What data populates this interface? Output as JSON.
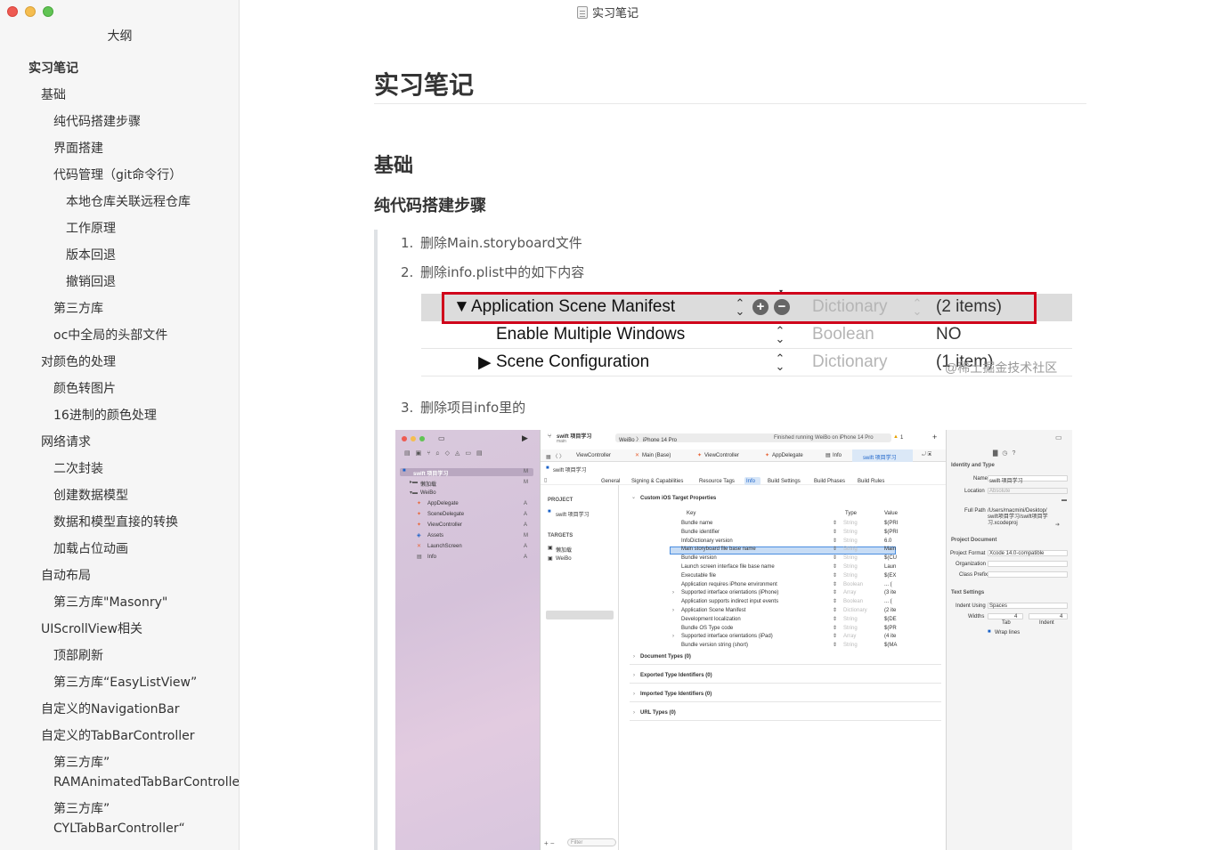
{
  "window": {
    "title": "实习笔记"
  },
  "sidebar": {
    "title": "大纲",
    "items": [
      {
        "label": "实习笔记",
        "level": 1
      },
      {
        "label": "基础",
        "level": 2
      },
      {
        "label": "纯代码搭建步骤",
        "level": 3
      },
      {
        "label": "界面搭建",
        "level": 3
      },
      {
        "label": "代码管理（git命令行）",
        "level": 3
      },
      {
        "label": "本地仓库关联远程仓库",
        "level": 4
      },
      {
        "label": "工作原理",
        "level": 4
      },
      {
        "label": "版本回退",
        "level": 4
      },
      {
        "label": "撤销回退",
        "level": 4
      },
      {
        "label": "第三方库",
        "level": 3
      },
      {
        "label": "oc中全局的头部文件",
        "level": 3
      },
      {
        "label": "对颜色的处理",
        "level": 2
      },
      {
        "label": "颜色转图片",
        "level": 3
      },
      {
        "label": "16进制的颜色处理",
        "level": 3
      },
      {
        "label": "网络请求",
        "level": 2
      },
      {
        "label": "二次封装",
        "level": 3
      },
      {
        "label": "创建数据模型",
        "level": 3
      },
      {
        "label": "数据和模型直接的转换",
        "level": 3
      },
      {
        "label": "加载占位动画",
        "level": 3
      },
      {
        "label": "自动布局",
        "level": 2
      },
      {
        "label": "第三方库\"Masonry\"",
        "level": 3
      },
      {
        "label": "UIScrollView相关",
        "level": 2
      },
      {
        "label": "顶部刷新",
        "level": 3
      },
      {
        "label": "第三方库“EasyListView”",
        "level": 3
      },
      {
        "label": "自定义的NavigationBar",
        "level": 2
      },
      {
        "label": "自定义的TabBarController",
        "level": 2
      },
      {
        "label": "第三方库” RAMAnimatedTabBarController“",
        "level": 3
      },
      {
        "label": "第三方库” CYLTabBarController“",
        "level": 3
      }
    ]
  },
  "document": {
    "h1": "实习笔记",
    "h2": "基础",
    "h3": "纯代码搭建步骤",
    "list": [
      {
        "num": "1.",
        "text": "删除Main.storyboard文件"
      },
      {
        "num": "2.",
        "text": "删除info.plist中的如下内容"
      },
      {
        "num": "3.",
        "text": "删除项目info里的"
      }
    ]
  },
  "plist_shot": {
    "rows": [
      {
        "key": "Application Scene Manifest",
        "type": "Dictionary",
        "value": "(2 items)"
      },
      {
        "key": "Enable Multiple Windows",
        "type": "Boolean",
        "value": "NO"
      },
      {
        "key": "Scene Configuration",
        "type": "Dictionary",
        "value": "(1 item)"
      }
    ],
    "watermark": "@稀土掘金技术社区",
    "highlight_color": "#d0021b"
  },
  "xcode_shot": {
    "project_name": "swift 项目学习",
    "branch": "main",
    "scheme": "WeiBo 〉 iPhone 14 Pro",
    "status": "Finished running WeiBo on iPhone 14 Pro",
    "warning_count": "1",
    "navigator": [
      "swift 项目学习",
      "懒加载",
      "WeiBo",
      "AppDelegate",
      "SceneDelegate",
      "ViewController",
      "Assets",
      "LaunchScreen",
      "Info"
    ],
    "navigator_badges": [
      "M",
      "M",
      "",
      "A",
      "A",
      "A",
      "M",
      "A",
      "A"
    ],
    "tabs": [
      "ViewController",
      "Main (Base)",
      "ViewController",
      "AppDelegate",
      "Info",
      "swift 项目学习"
    ],
    "breadcrumb": "swift 项目学习",
    "segments": [
      "General",
      "Signing & Capabilities",
      "Resource Tags",
      "Info",
      "Build Settings",
      "Build Phases",
      "Build Rules"
    ],
    "project_header": "PROJECT",
    "project_item": "swift 项目学习",
    "targets_header": "TARGETS",
    "targets": [
      "懒加载",
      "WeiBo"
    ],
    "section_title": "Custom iOS Target Properties",
    "col_key": "Key",
    "col_type": "Type",
    "col_value": "Value",
    "rows": [
      {
        "key": "Bundle name",
        "type": "String",
        "value": "$(PRI"
      },
      {
        "key": "Bundle identifier",
        "type": "String",
        "value": "$(PRI"
      },
      {
        "key": "InfoDictionary version",
        "type": "String",
        "value": "6.0"
      },
      {
        "key": "Main storyboard file base name",
        "type": "String",
        "value": "Main"
      },
      {
        "key": "Bundle version",
        "type": "String",
        "value": "$(CU"
      },
      {
        "key": "Launch screen interface file base name",
        "type": "String",
        "value": "Laun"
      },
      {
        "key": "Executable file",
        "type": "String",
        "value": "$(EX"
      },
      {
        "key": "Application requires iPhone environment",
        "type": "Boolean",
        "value": "... ( "
      },
      {
        "key": "Supported interface orientations (iPhone)",
        "type": "Array",
        "value": "(3 ite"
      },
      {
        "key": "Application supports indirect input events",
        "type": "Boolean",
        "value": "... ( "
      },
      {
        "key": "Application Scene Manifest",
        "type": "Dictionary",
        "value": "(2 ite"
      },
      {
        "key": "Development localization",
        "type": "String",
        "value": "$(DE"
      },
      {
        "key": "Bundle OS Type code",
        "type": "String",
        "value": "$(PR"
      },
      {
        "key": "Supported interface orientations (iPad)",
        "type": "Array",
        "value": "(4 ite"
      },
      {
        "key": "Bundle version string (short)",
        "type": "String",
        "value": "$(MA"
      }
    ],
    "sections": [
      "Document Types (0)",
      "Exported Type Identifiers (0)",
      "Imported Type Identifiers (0)",
      "URL Types (0)"
    ],
    "filter_placeholder": "Filter",
    "inspector": {
      "identity_header": "Identity and Type",
      "name_label": "Name",
      "name_value": "swift 项目学习",
      "location_label": "Location",
      "location_value": "Absolute",
      "fullpath_label": "Full Path",
      "fullpath_value": "/Users/macmini/Desktop/ swift项目学习/swift项目学 习.xcodeproj",
      "project_doc_header": "Project Document",
      "format_label": "Project Format",
      "format_value": "Xcode 14.0-compatible",
      "org_label": "Organization",
      "prefix_label": "Class Prefix",
      "text_settings_header": "Text Settings",
      "indent_label": "Indent Using",
      "indent_value": "Spaces",
      "widths_label": "Widths",
      "tab_value": "4",
      "indent_width_value": "4",
      "tab_label": "Tab",
      "indent_sub_label": "Indent",
      "wrap_label": "Wrap lines"
    }
  }
}
